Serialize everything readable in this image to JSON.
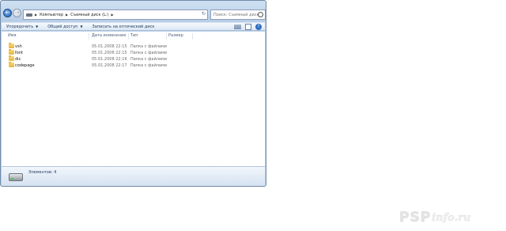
{
  "explorer": {
    "address": {
      "crumbs": [
        "Компьютер",
        "Съемный диск (L:)"
      ],
      "refresh_icon": "refresh-icon"
    },
    "search": {
      "placeholder": "Поиск: Съемный диск (L:)"
    },
    "toolbar": {
      "organize": "Упорядочить",
      "share": "Общий доступ",
      "burn": "Записать на оптический диск"
    },
    "columns": {
      "name": "Имя",
      "date": "Дата изменения",
      "type": "Тип",
      "size": "Размер"
    },
    "files": [
      {
        "name": "vsh",
        "date": "05.01.2008 22:15",
        "type": "Папка с файлами"
      },
      {
        "name": "font",
        "date": "05.01.2008 22:15",
        "type": "Папка с файлами"
      },
      {
        "name": "dic",
        "date": "05.01.2008 22:16",
        "type": "Папка с файлами"
      },
      {
        "name": "codepage",
        "date": "05.01.2008 22:17",
        "type": "Папка с файлами"
      }
    ],
    "status": {
      "text": "Элементов: 4"
    }
  },
  "watermark": {
    "psp": "PSP",
    "info": "info.ru"
  },
  "colors": {
    "frame": "#bcd1e8",
    "folder": "#e4b43c",
    "accent": "#2f6fc2"
  }
}
